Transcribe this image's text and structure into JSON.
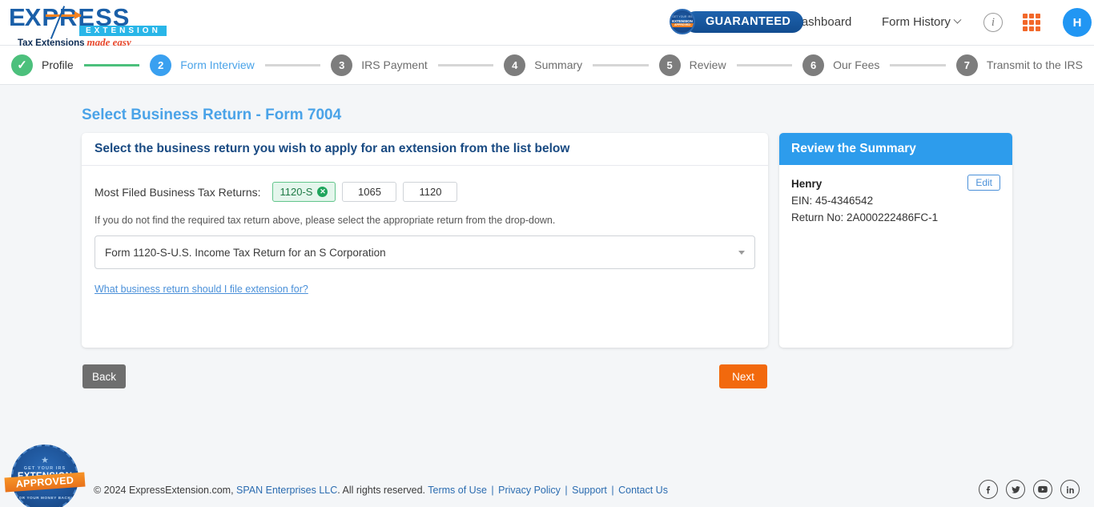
{
  "brand": {
    "logo_main": "XPRESS",
    "logo_first_letter": "E",
    "logo_sub": "EXTENSION",
    "tagline": "Tax Extensions",
    "tagline_em": "made easy"
  },
  "header": {
    "guaranteed_label": "GUARANTEED",
    "seal_top": "GET YOUR IRS",
    "seal_mid": "EXTENSION",
    "seal_ribbon": "APPROVED",
    "dashboard": "Dashboard",
    "form_history": "Form History",
    "info_icon_glyph": "i",
    "avatar_initial": "H",
    "accent_blue": "#2196f3",
    "accent_orange": "#f2682a"
  },
  "stepper": {
    "steps": [
      {
        "num": "✓",
        "label": "Profile",
        "state": "done"
      },
      {
        "num": "2",
        "label": "Form Interview",
        "state": "active"
      },
      {
        "num": "3",
        "label": "IRS Payment",
        "state": "todo"
      },
      {
        "num": "4",
        "label": "Summary",
        "state": "todo"
      },
      {
        "num": "5",
        "label": "Review",
        "state": "todo"
      },
      {
        "num": "6",
        "label": "Our Fees",
        "state": "todo"
      },
      {
        "num": "7",
        "label": "Transmit to the IRS",
        "state": "todo"
      }
    ]
  },
  "main": {
    "page_title": "Select Business Return - Form 7004",
    "card_heading": "Select the business return you wish to apply for an extension from the list below",
    "returns_label": "Most Filed Business Tax Returns:",
    "pills": [
      {
        "label": "1120-S",
        "selected": true,
        "remove_glyph": "✕"
      },
      {
        "label": "1065",
        "selected": false
      },
      {
        "label": "1120",
        "selected": false
      }
    ],
    "hint": "If you do not find the required tax return above, please select the appropriate return from the drop-down.",
    "select_value": "Form 1120-S-U.S. Income Tax Return for an S Corporation",
    "help_link": "What business return should I file extension for?"
  },
  "summary": {
    "title": "Review the Summary",
    "name": "Henry",
    "ein": "EIN: 45-4346542",
    "return_no": "Return No: 2A000222486FC-1",
    "edit_label": "Edit",
    "header_color": "#2d9cec"
  },
  "actions": {
    "back_label": "Back",
    "next_label": "Next",
    "back_color": "#6e6e6e",
    "next_color": "#f2690d"
  },
  "footer": {
    "copyright_prefix": "© 2024 ExpressExtension.com, ",
    "company": "SPAN Enterprises LLC",
    "rights": ". All rights reserved. ",
    "links": [
      "Terms of Use",
      "Privacy Policy",
      "Support",
      "Contact Us"
    ],
    "badge": {
      "top": "GET YOUR IRS",
      "mid": "EXTENSION",
      "ribbon": "APPROVED",
      "bottom": "OR YOUR MONEY BACK"
    },
    "socials": [
      "facebook-icon",
      "twitter-icon",
      "youtube-icon",
      "linkedin-icon"
    ]
  }
}
